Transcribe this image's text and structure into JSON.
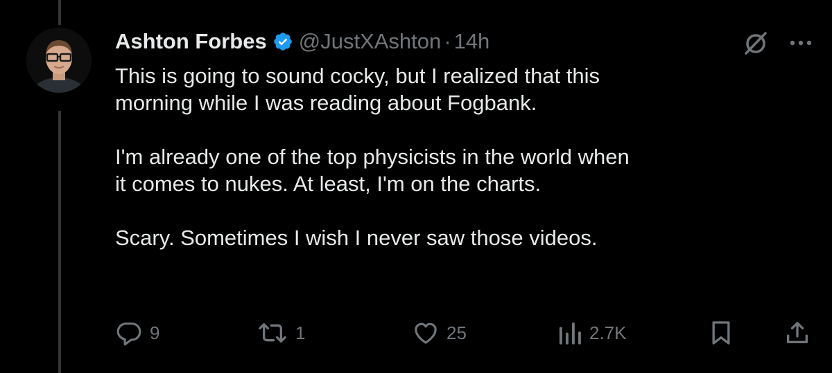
{
  "tweet": {
    "author_name": "Ashton Forbes",
    "handle": "@JustXAshton",
    "separator": "·",
    "time": "14h",
    "paragraphs": [
      [
        "This is going to sound cocky, but I realized that this",
        "morning while I was reading about Fogbank."
      ],
      [
        "I'm already one of the top physicists in the world when",
        "it comes to nukes. At least, I'm on the charts."
      ],
      [
        "Scary. Sometimes I wish I never saw those videos."
      ]
    ]
  },
  "actions": {
    "replies": "9",
    "retweets": "1",
    "likes": "25",
    "views": "2.7K"
  },
  "icons": {
    "verified": "verified-badge-icon",
    "grok": "grok-icon",
    "more": "more-icon",
    "reply": "reply-icon",
    "retweet": "retweet-icon",
    "like": "heart-icon",
    "views": "views-icon",
    "bookmark": "bookmark-icon",
    "share": "share-icon"
  },
  "colors": {
    "background": "#000000",
    "text": "#e7e9ea",
    "muted": "#71767b",
    "verified": "#1d9bf0"
  }
}
